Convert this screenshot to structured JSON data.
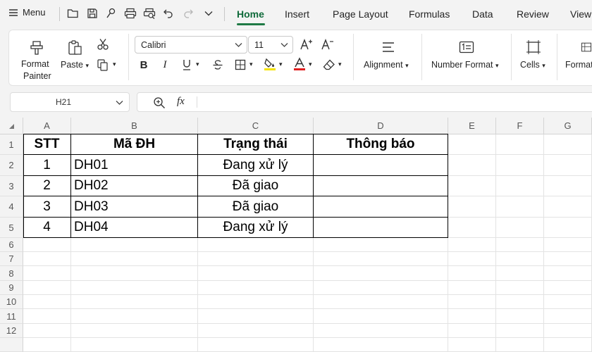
{
  "topbar": {
    "menu_label": "Menu",
    "tabs": [
      "Home",
      "Insert",
      "Page Layout",
      "Formulas",
      "Data",
      "Review",
      "View"
    ]
  },
  "ribbon": {
    "format_painter_label_1": "Format",
    "format_painter_label_2": "Painter",
    "paste_label": "Paste",
    "font_name": "Calibri",
    "font_size": "11",
    "alignment_label": "Alignment",
    "number_format_label": "Number Format",
    "cells_label": "Cells",
    "format_label": "Format",
    "highlight_color": "#f5e300",
    "font_color": "#e02020"
  },
  "formula_bar": {
    "name_box": "H21",
    "fx": "fx",
    "value": ""
  },
  "sheet": {
    "columns": [
      "A",
      "B",
      "C",
      "D",
      "E",
      "F",
      "G"
    ],
    "rows": [
      "1",
      "2",
      "3",
      "4",
      "5",
      "6",
      "7",
      "8",
      "9",
      "10",
      "11",
      "12"
    ],
    "header": [
      "STT",
      "Mã ĐH",
      "Trạng thái",
      "Thông báo"
    ],
    "data": [
      [
        "1",
        "DH01",
        "Đang xử lý",
        ""
      ],
      [
        "2",
        "DH02",
        "Đã giao",
        ""
      ],
      [
        "3",
        "DH03",
        "Đã giao",
        ""
      ],
      [
        "4",
        "DH04",
        "Đang xử lý",
        ""
      ]
    ]
  }
}
